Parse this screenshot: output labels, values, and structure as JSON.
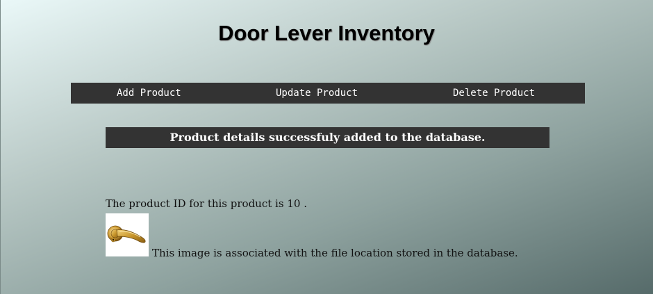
{
  "page": {
    "title": "Door Lever Inventory"
  },
  "nav": {
    "add_label": "Add Product",
    "update_label": "Update Product",
    "delete_label": "Delete Product"
  },
  "banner": {
    "message": "Product details successfuly added to the database."
  },
  "result": {
    "id_text_prefix": "The product ID for this product is",
    "product_id": "10",
    "id_text_suffix": ".",
    "image_icon": "door-lever-image",
    "caption": "This image is associated with the file location stored in the database."
  }
}
